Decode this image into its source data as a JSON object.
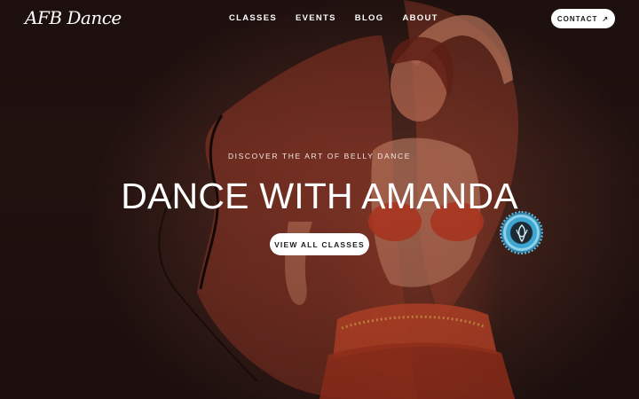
{
  "brand": {
    "logo_text": "AFB Dance"
  },
  "nav": {
    "items": [
      {
        "label": "CLASSES"
      },
      {
        "label": "EVENTS"
      },
      {
        "label": "BLOG"
      },
      {
        "label": "ABOUT"
      }
    ],
    "contact_label": "CONTACT",
    "contact_icon": "arrow-up-right-icon"
  },
  "hero": {
    "eyebrow": "DISCOVER THE ART OF BELLY DANCE",
    "headline": "DANCE WITH AMANDA",
    "cta_label": "VIEW ALL CLASSES",
    "image": "belly-dancer-with-veil-photo"
  },
  "badge": {
    "icon": "certification-seal-icon"
  },
  "colors": {
    "background": "#3b1f1a",
    "accent_veil": "#b2442e",
    "button_bg": "#ffffff",
    "badge_blue": "#3da5cf"
  }
}
